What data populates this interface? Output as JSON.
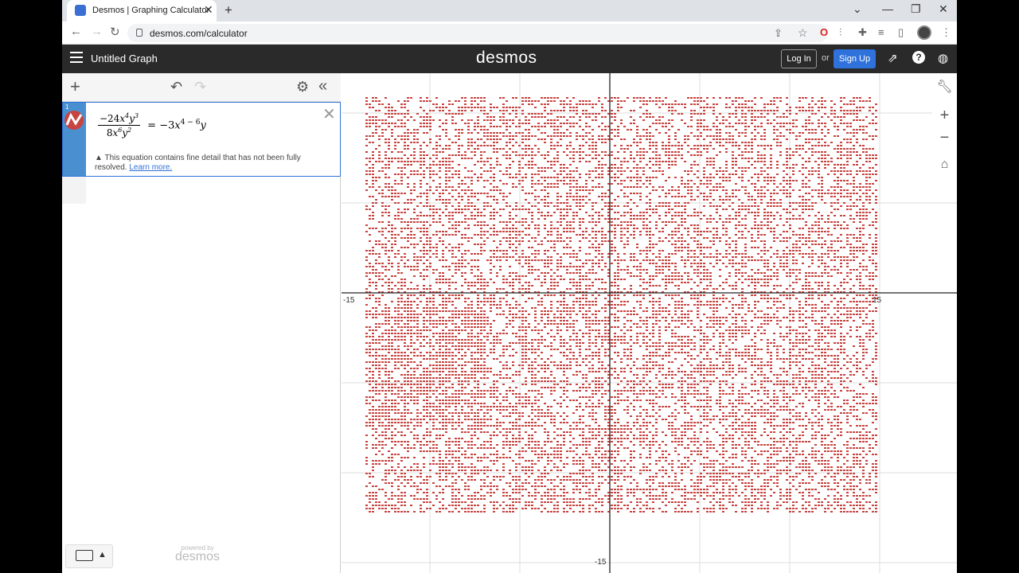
{
  "browser": {
    "tab_title": "Desmos | Graphing Calculator",
    "url": "desmos.com/calculator",
    "new_tab_label": "+",
    "close_tab_label": "✕"
  },
  "header": {
    "graph_title": "Untitled Graph",
    "logo": "desmos",
    "login_label": "Log In",
    "or_label": "or",
    "signup_label": "Sign Up"
  },
  "expression": {
    "index": "1",
    "lhs_num_coef": "−24",
    "lhs_den_coef": "8",
    "x_num_exp": "4",
    "y_num_exp": "3",
    "x_den_exp": "6",
    "y_den_exp": "2",
    "rhs_coef": "= −3",
    "rhs_x_exp": "4 − 6",
    "warning": "This equation contains fine detail that has not been fully resolved.",
    "learn_more": "Learn more."
  },
  "footer": {
    "powered_by": "powered by",
    "brand": "desmos"
  },
  "graph": {
    "x_min_label": "-15",
    "x_max_label": "15",
    "y_min_label": "-15",
    "plot_color": "#c74440"
  },
  "icons": {
    "keyboard": "keyboard-icon",
    "settings": "gear-icon",
    "undo": "undo-icon",
    "redo": "redo-icon"
  }
}
